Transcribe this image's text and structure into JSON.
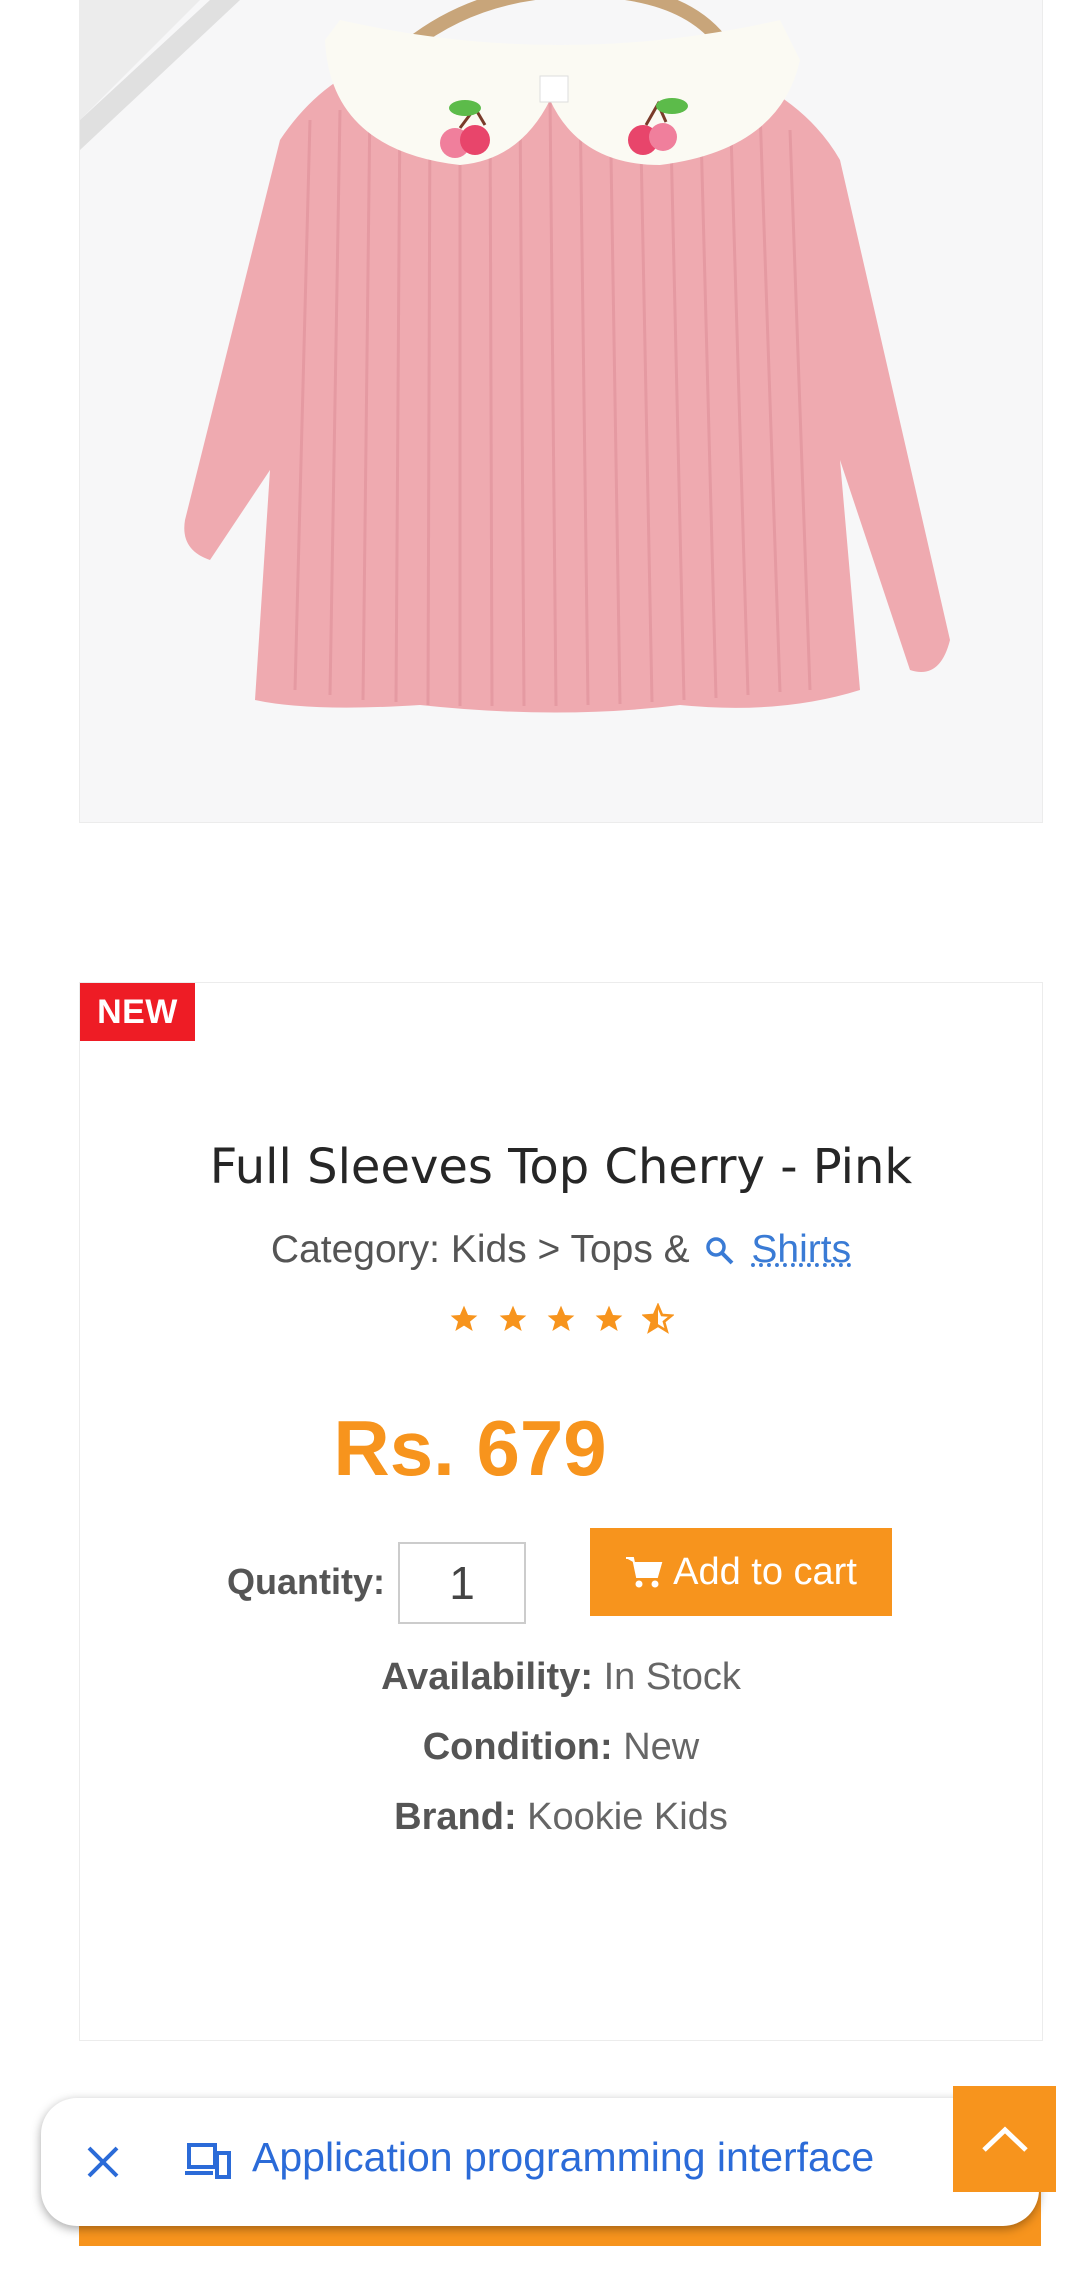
{
  "product": {
    "badge": "NEW",
    "title": "Full Sleeves Top Cherry - Pink",
    "category_prefix": "Category: Kids > Tops &",
    "category_link": "Shirts",
    "rating": 4.5,
    "price": "Rs. 679",
    "quantity_label": "Quantity:",
    "quantity_value": "1",
    "add_to_cart": "Add to cart",
    "availability_label": "Availability:",
    "availability_value": "In Stock",
    "condition_label": "Condition:",
    "condition_value": "New",
    "brand_label": "Brand:",
    "brand_value": "Kookie Kids"
  },
  "popup": {
    "text": "Application programming interface",
    "close_icon": "close-icon",
    "devices_icon": "devices-icon"
  },
  "scroll_top": {
    "icon": "chevron-up-icon"
  },
  "colors": {
    "accent": "#f7941d",
    "badge": "#ee1c25",
    "link": "#3a7bd5",
    "shirt": "#efaab0"
  }
}
